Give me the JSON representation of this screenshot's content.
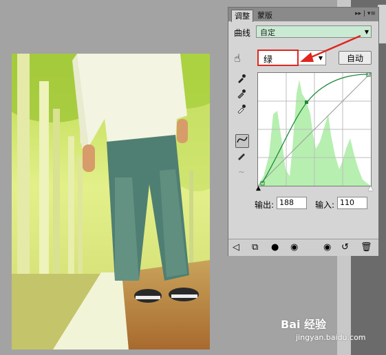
{
  "panel": {
    "tabs": [
      "调整",
      "蒙版"
    ],
    "tab_controls": "▸▸ | ▾≡",
    "curves_label": "曲线",
    "preset_value": "自定",
    "channel_value": "绿",
    "auto_label": "自动",
    "output_label": "输出:",
    "output_value": "188",
    "input_label": "输入:",
    "input_value": "110"
  },
  "curve_point": {
    "input": 110,
    "output": 188
  },
  "watermark": {
    "brand": "Bai 经验",
    "url": "jingyan.baidu.com"
  },
  "colors": {
    "highlight": "#e0261e",
    "preset_bg": "#c9ead3",
    "histogram": "#b6efb0",
    "curve": "#1f8a3a"
  }
}
